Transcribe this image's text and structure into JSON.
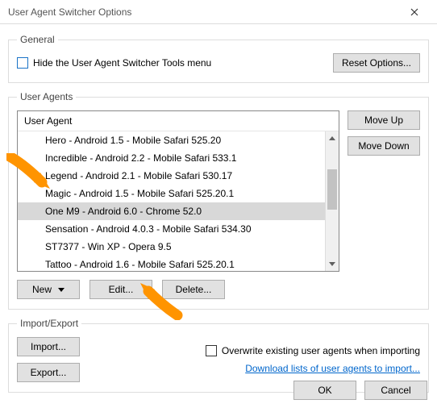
{
  "window": {
    "title": "User Agent Switcher Options"
  },
  "general": {
    "legend": "General",
    "hide_menu_label": "Hide the User Agent Switcher Tools menu",
    "reset_label": "Reset Options..."
  },
  "user_agents": {
    "legend": "User Agents",
    "header": "User Agent",
    "items": [
      "Hero - Android 1.5 - Mobile Safari 525.20",
      "Incredible - Android 2.2 - Mobile Safari 533.1",
      "Legend - Android 2.1 - Mobile Safari 530.17",
      "Magic - Android 1.5 - Mobile Safari 525.20.1",
      "One M9 - Android 6.0 - Chrome 52.0",
      "Sensation - Android 4.0.3 - Mobile Safari 534.30",
      "ST7377 - Win XP - Opera 9.5",
      "Tattoo - Android 1.6 - Mobile Safari 525.20.1"
    ],
    "selected_index": 4,
    "move_up": "Move Up",
    "move_down": "Move Down",
    "new_label": "New",
    "edit_label": "Edit...",
    "delete_label": "Delete..."
  },
  "import_export": {
    "legend": "Import/Export",
    "import_label": "Import...",
    "export_label": "Export...",
    "overwrite_label": "Overwrite existing user agents when importing",
    "download_link": "Download lists of user agents to import..."
  },
  "footer": {
    "ok": "OK",
    "cancel": "Cancel"
  }
}
